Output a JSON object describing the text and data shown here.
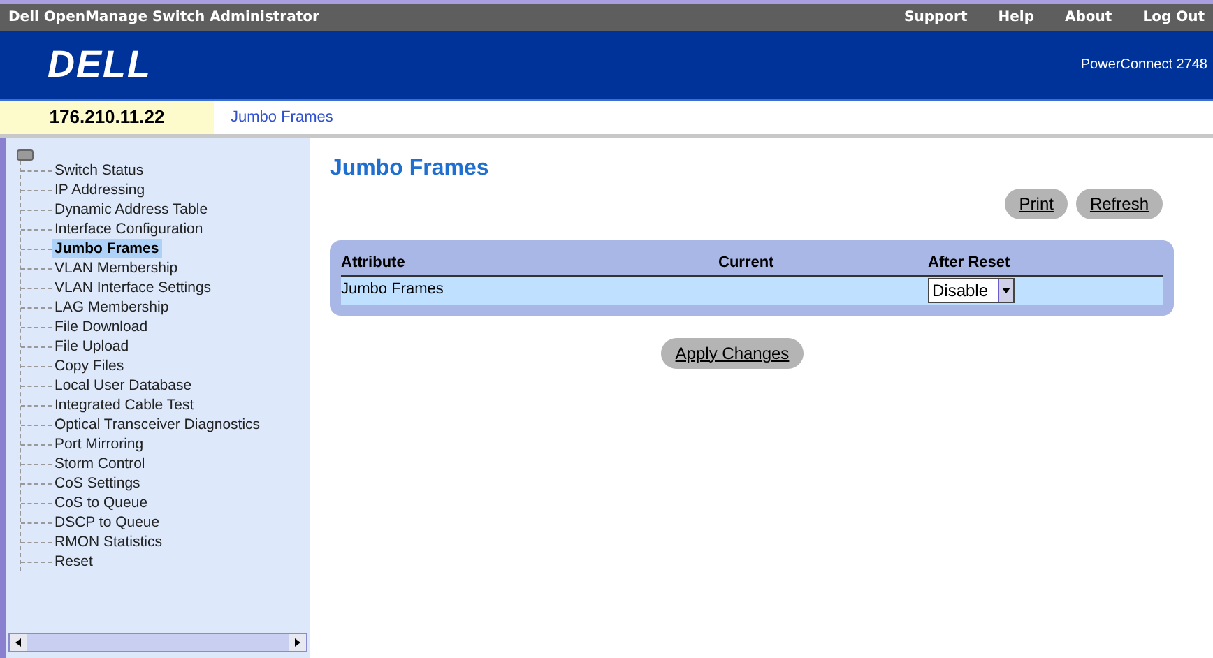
{
  "title_bar": {
    "title": "Dell OpenManage Switch Administrator",
    "links": [
      "Support",
      "Help",
      "About",
      "Log Out"
    ]
  },
  "header": {
    "logo": "DELL",
    "model": "PowerConnect 2748"
  },
  "breadcrumb": {
    "ip": "176.210.11.22",
    "page": "Jumbo Frames"
  },
  "sidebar": {
    "items": [
      {
        "label": "Switch Status",
        "selected": false
      },
      {
        "label": "IP Addressing",
        "selected": false
      },
      {
        "label": "Dynamic Address Table",
        "selected": false
      },
      {
        "label": "Interface Configuration",
        "selected": false
      },
      {
        "label": "Jumbo Frames",
        "selected": true
      },
      {
        "label": "VLAN Membership",
        "selected": false
      },
      {
        "label": "VLAN Interface Settings",
        "selected": false
      },
      {
        "label": "LAG Membership",
        "selected": false
      },
      {
        "label": "File Download",
        "selected": false
      },
      {
        "label": "File Upload",
        "selected": false
      },
      {
        "label": "Copy Files",
        "selected": false
      },
      {
        "label": "Local User Database",
        "selected": false
      },
      {
        "label": "Integrated Cable Test",
        "selected": false
      },
      {
        "label": "Optical Transceiver Diagnostics",
        "selected": false
      },
      {
        "label": "Port Mirroring",
        "selected": false
      },
      {
        "label": "Storm Control",
        "selected": false
      },
      {
        "label": "CoS Settings",
        "selected": false
      },
      {
        "label": "CoS to Queue",
        "selected": false
      },
      {
        "label": "DSCP to Queue",
        "selected": false
      },
      {
        "label": "RMON Statistics",
        "selected": false
      },
      {
        "label": "Reset",
        "selected": false
      }
    ]
  },
  "main": {
    "heading": "Jumbo Frames",
    "top_buttons": [
      "Print",
      "Refresh"
    ],
    "table": {
      "columns": [
        "Attribute",
        "Current",
        "After Reset"
      ],
      "rows": [
        {
          "attribute": "Jumbo Frames",
          "current": "",
          "after_reset": "Disable"
        }
      ]
    },
    "apply_button": "Apply Changes"
  }
}
